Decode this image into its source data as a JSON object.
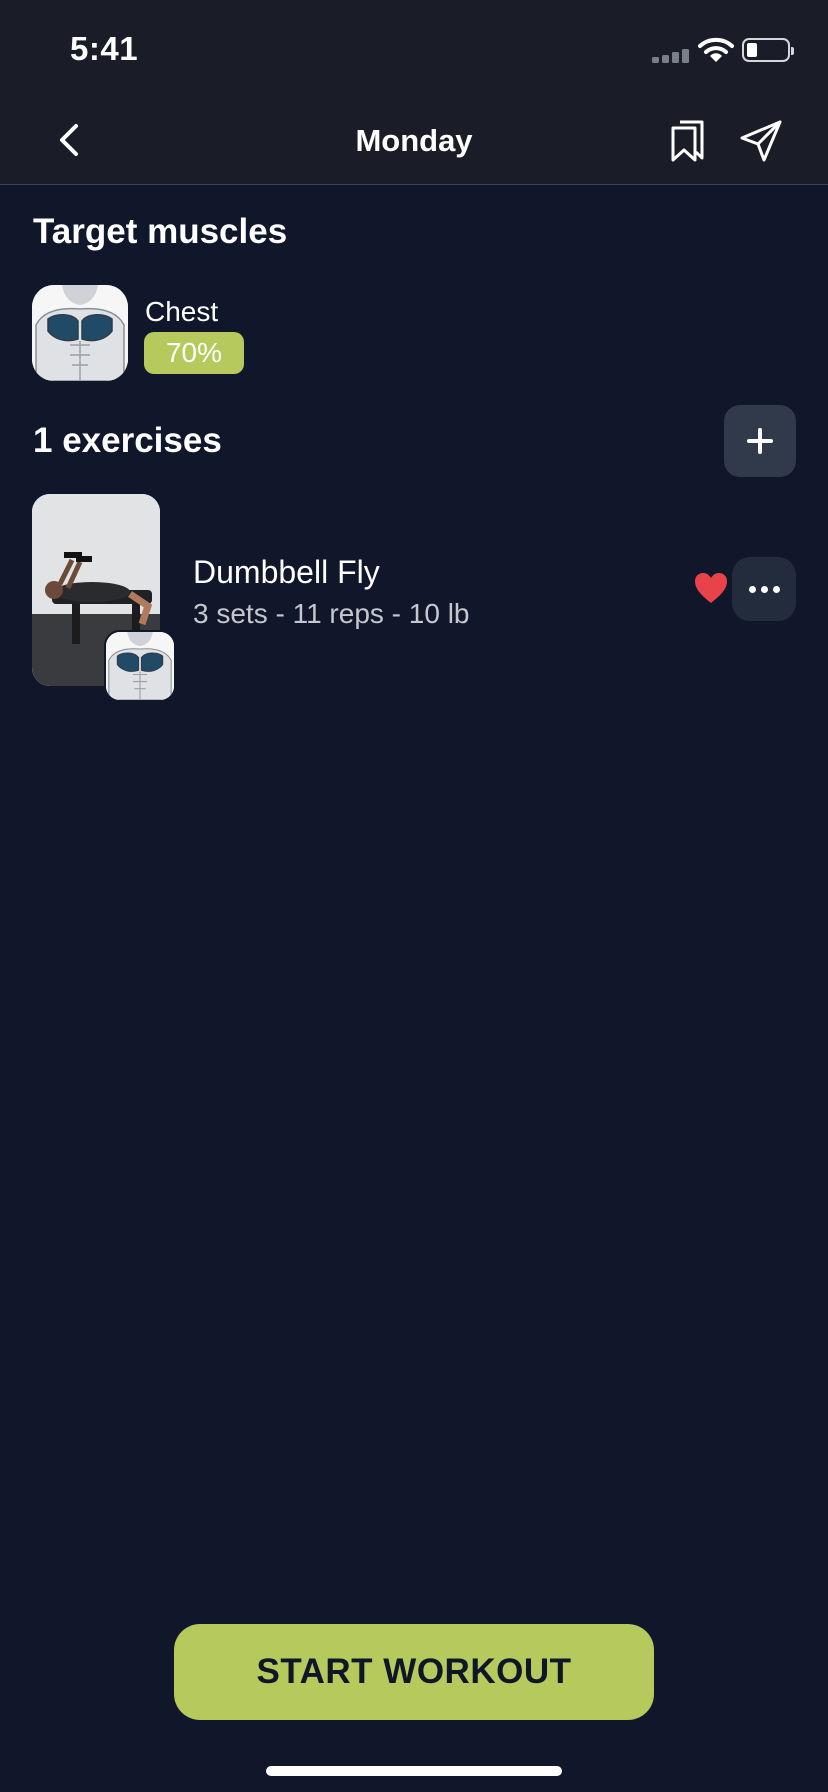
{
  "status_bar": {
    "time": "5:41"
  },
  "header": {
    "title": "Monday"
  },
  "target_muscles": {
    "title": "Target muscles",
    "items": [
      {
        "name": "Chest",
        "percent": "70%"
      }
    ]
  },
  "exercises": {
    "count_label": "1 exercises",
    "items": [
      {
        "name": "Dumbbell Fly",
        "details": "3 sets - 11 reps - 10 lb",
        "favorited": true
      }
    ]
  },
  "footer": {
    "start_label": "START WORKOUT"
  },
  "colors": {
    "background": "#10172a",
    "header_background": "#1a1c27",
    "accent": "#b5c95c",
    "favorite": "#e8434a",
    "button_dark": "#303a4b"
  }
}
